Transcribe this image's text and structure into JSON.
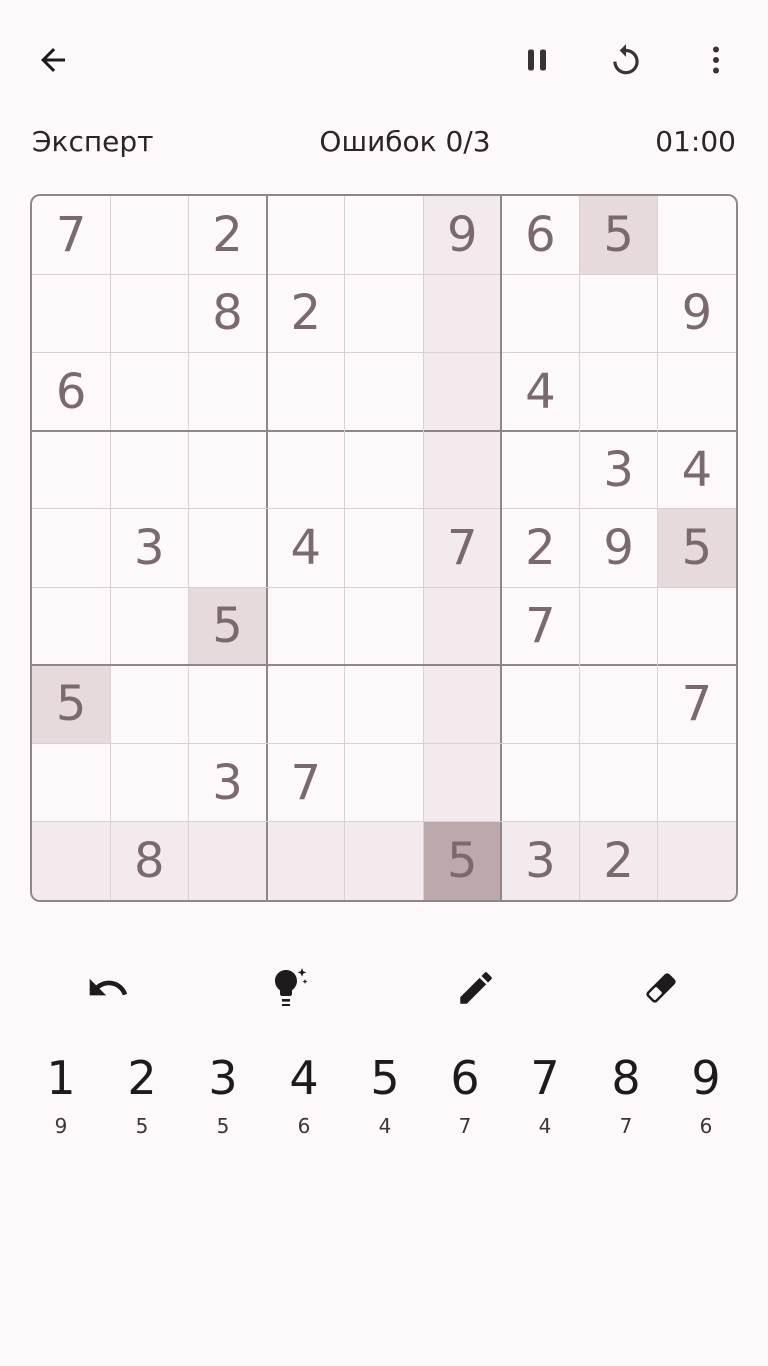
{
  "header": {
    "icons": {
      "back": "arrow-left-icon",
      "pause": "pause-icon",
      "restart": "restart-icon",
      "menu": "more-vertical-icon"
    }
  },
  "status": {
    "level": "Эксперт",
    "mistakes": "Ошибок 0/3",
    "timer": "01:00"
  },
  "board": {
    "selected": [
      8,
      5
    ],
    "highlight_value": "5",
    "cells": [
      [
        "7",
        "",
        "2",
        "",
        "",
        "9",
        "6",
        "5",
        ""
      ],
      [
        "",
        "",
        "8",
        "2",
        "",
        "",
        "",
        "",
        "9"
      ],
      [
        "6",
        "",
        "",
        "",
        "",
        "",
        "4",
        "",
        ""
      ],
      [
        "",
        "",
        "",
        "",
        "",
        "",
        "",
        "3",
        "4"
      ],
      [
        "",
        "3",
        "",
        "4",
        "",
        "7",
        "2",
        "9",
        "5"
      ],
      [
        "",
        "",
        "5",
        "",
        "",
        "",
        "7",
        "",
        ""
      ],
      [
        "5",
        "",
        "",
        "",
        "",
        "",
        "",
        "",
        "7"
      ],
      [
        "",
        "",
        "3",
        "7",
        "",
        "",
        "",
        "",
        ""
      ],
      [
        "",
        "8",
        "",
        "",
        "",
        "5",
        "3",
        "2",
        ""
      ]
    ]
  },
  "tools": {
    "undo": "undo-icon",
    "hint": "lightbulb-sparkle-icon",
    "notes": "pencil-icon",
    "erase": "eraser-icon"
  },
  "numpad": [
    {
      "digit": "1",
      "remaining": "9"
    },
    {
      "digit": "2",
      "remaining": "5"
    },
    {
      "digit": "3",
      "remaining": "5"
    },
    {
      "digit": "4",
      "remaining": "6"
    },
    {
      "digit": "5",
      "remaining": "4"
    },
    {
      "digit": "6",
      "remaining": "7"
    },
    {
      "digit": "7",
      "remaining": "4"
    },
    {
      "digit": "8",
      "remaining": "7"
    },
    {
      "digit": "9",
      "remaining": "6"
    }
  ],
  "colors": {
    "background": "#fdf8f9",
    "digit": "#7a6a6d",
    "highlight_rowcol": "#f2eaec",
    "highlight_same": "#e6dadc",
    "highlight_selected": "#bda9ab"
  }
}
